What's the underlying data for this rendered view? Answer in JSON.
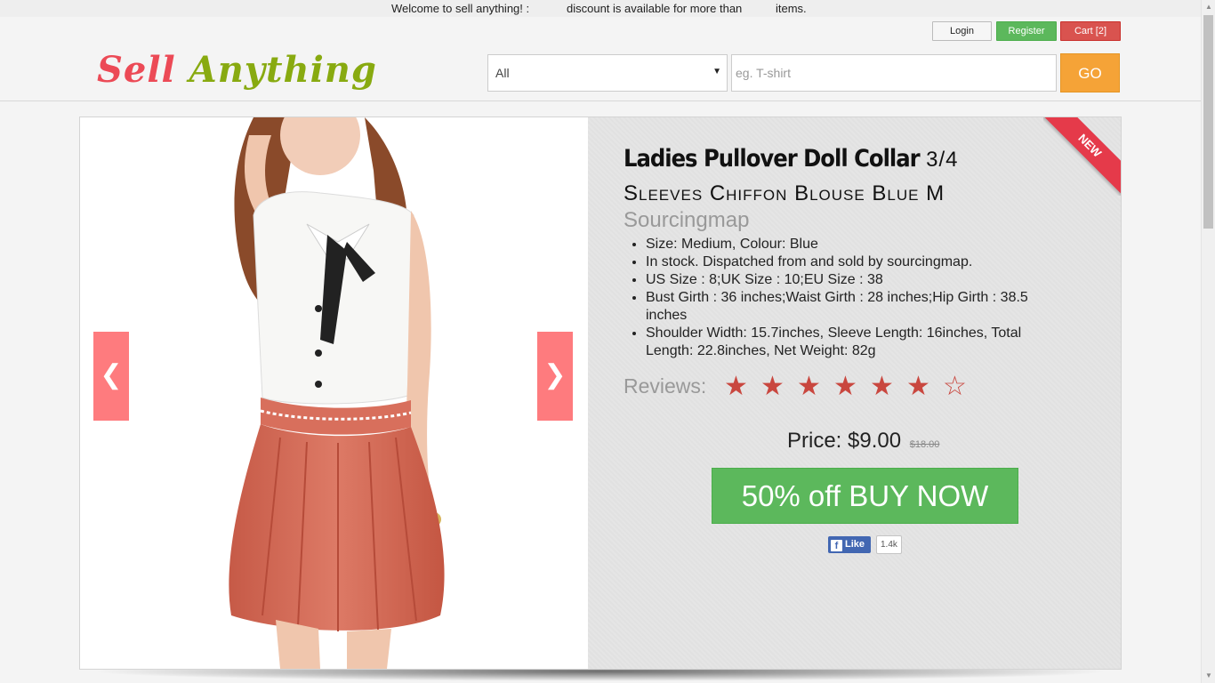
{
  "topbar": {
    "welcome": "Welcome to sell anything! :",
    "discount": "discount is available for more than",
    "items": "items."
  },
  "account": {
    "login": "Login",
    "register": "Register",
    "cart": "Cart [2]"
  },
  "logo": {
    "word1": "Sell",
    "word2": "Anything"
  },
  "search": {
    "category": "All",
    "placeholder": "eg. T-shirt",
    "go": "GO"
  },
  "product": {
    "title_bold": "Ladies Pullover Doll Collar",
    "title_rest": "3/4 Sleeves Chiffon Blouse Blue M",
    "brand": "Sourcingmap",
    "features": [
      "Size: Medium, Colour: Blue",
      "In stock. Dispatched from and sold by sourcingmap.",
      "US Size : 8;UK Size : 10;EU Size : 38",
      "Bust Girth : 36 inches;Waist Girth : 28 inches;Hip Girth : 38.5 inches",
      "Shoulder Width: 15.7inches, Sleeve Length: 16inches, Total Length: 22.8inches, Net Weight: 82g"
    ],
    "reviews_label": "Reviews:",
    "rating": 6,
    "rating_max": 7,
    "price_label": "Price: $9.00",
    "old_price": "$18.00",
    "buy_label": "50% off BUY NOW",
    "ribbon": "NEW"
  },
  "social": {
    "like": "Like",
    "count": "1.4k"
  },
  "carousel": {
    "prev": "❮",
    "next": "❯"
  },
  "colors": {
    "logo_red": "#ec4a56",
    "logo_green": "#88aa10",
    "go_orange": "#f5a337",
    "buy_green": "#5cb85c",
    "star_red": "#c9473f",
    "ribbon_red": "#e53a4a",
    "nav_pink": "#fe7b7e"
  }
}
